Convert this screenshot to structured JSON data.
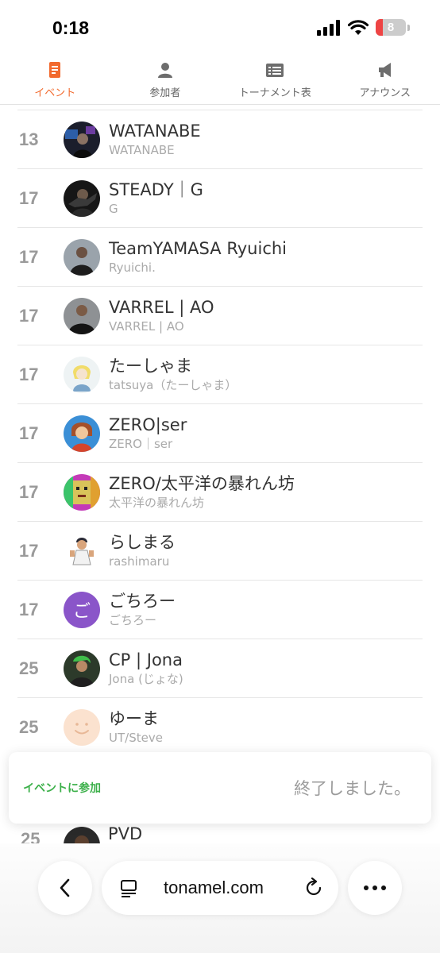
{
  "status_bar": {
    "time": "0:18",
    "battery": "8"
  },
  "tabs": [
    {
      "label": "イベント",
      "icon": "event-icon",
      "active": true
    },
    {
      "label": "参加者",
      "icon": "participants-icon",
      "active": false
    },
    {
      "label": "トーナメント表",
      "icon": "bracket-icon",
      "active": false
    },
    {
      "label": "アナウンス",
      "icon": "megaphone-icon",
      "active": false
    }
  ],
  "participants": [
    {
      "rank": "13",
      "name": "WATANABE",
      "sub": "WATANABE"
    },
    {
      "rank": "17",
      "name": "STEADY｜G",
      "sub": "G"
    },
    {
      "rank": "17",
      "name": "TeamYAMASA Ryuichi",
      "sub": "Ryuichi."
    },
    {
      "rank": "17",
      "name": "VARREL | AO",
      "sub": "VARREL | AO"
    },
    {
      "rank": "17",
      "name": "たーしゃま",
      "sub": "tatsuya（たーしゃま）"
    },
    {
      "rank": "17",
      "name": "ZERO|ser",
      "sub": "ZERO｜ser"
    },
    {
      "rank": "17",
      "name": "ZERO/太平洋の暴れん坊",
      "sub": "太平洋の暴れん坊"
    },
    {
      "rank": "17",
      "name": "らしまる",
      "sub": "rashimaru"
    },
    {
      "rank": "17",
      "name": "ごちろー",
      "sub": "ごちろー",
      "initial": "ご"
    },
    {
      "rank": "25",
      "name": "CP | Jona",
      "sub": "Jona (じょな)"
    },
    {
      "rank": "25",
      "name": "ゆーま",
      "sub": "UT/Steve"
    }
  ],
  "partial_row": {
    "rank": "25",
    "name": "PVD"
  },
  "notice": {
    "label": "イベントに参加",
    "status": "終了しました。"
  },
  "browser": {
    "url": "tonamel.com"
  },
  "colors": {
    "accent": "#f26a2e",
    "join_green": "#3cb04a",
    "rank_gray": "#9a9a9a"
  }
}
